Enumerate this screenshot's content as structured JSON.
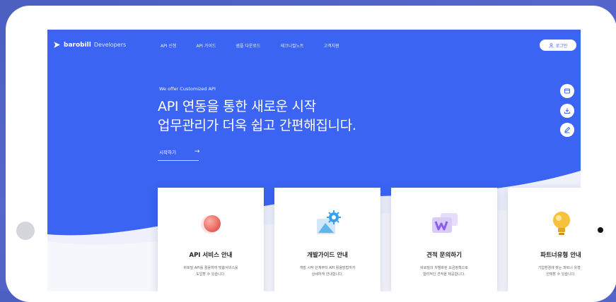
{
  "brand": {
    "name": "barobill",
    "sub": "Developers"
  },
  "nav": [
    "API 신청",
    "API 가이드",
    "샘플 다운로드",
    "테크니컬노트",
    "고객지원"
  ],
  "login_label": "로그인",
  "hero": {
    "eyebrow": "We offer Customized API",
    "line1": "API 연동을 통한 새로운 시작",
    "line2": "업무관리가 더욱 쉽고 간편해집니다.",
    "start": "시작하기",
    "arrow": "→"
  },
  "side_buttons": [
    "document-icon",
    "download-icon",
    "edit-icon"
  ],
  "cards": [
    {
      "title": "API 서비스 안내",
      "desc1": "바로빌 API를 활용하여 맞춤서비스를",
      "desc2": "도입할 수 있습니다.",
      "icon": "sphere-icon",
      "color": "#e2564f"
    },
    {
      "title": "개발가이드 안내",
      "desc1": "개발 시작 단계부터 API 활용방법까지",
      "desc2": "상세하게 안내합니다.",
      "icon": "gear-icon",
      "color": "#3aa0e8"
    },
    {
      "title": "견적 문의하기",
      "desc1": "바로빌의 차별화된 요금정책으로",
      "desc2": "합리적인 견적을 제공합니다.",
      "icon": "quote-icon",
      "color": "#8a5cf0"
    },
    {
      "title": "파트너유형 안내",
      "desc1": "기업환경에 맞는 파트너 유형을",
      "desc2": "선택할 수 있습니다.",
      "icon": "bulb-icon",
      "color": "#f5c23a"
    }
  ],
  "colors": {
    "primary": "#3b64f2",
    "background": "#4d5fc4"
  }
}
